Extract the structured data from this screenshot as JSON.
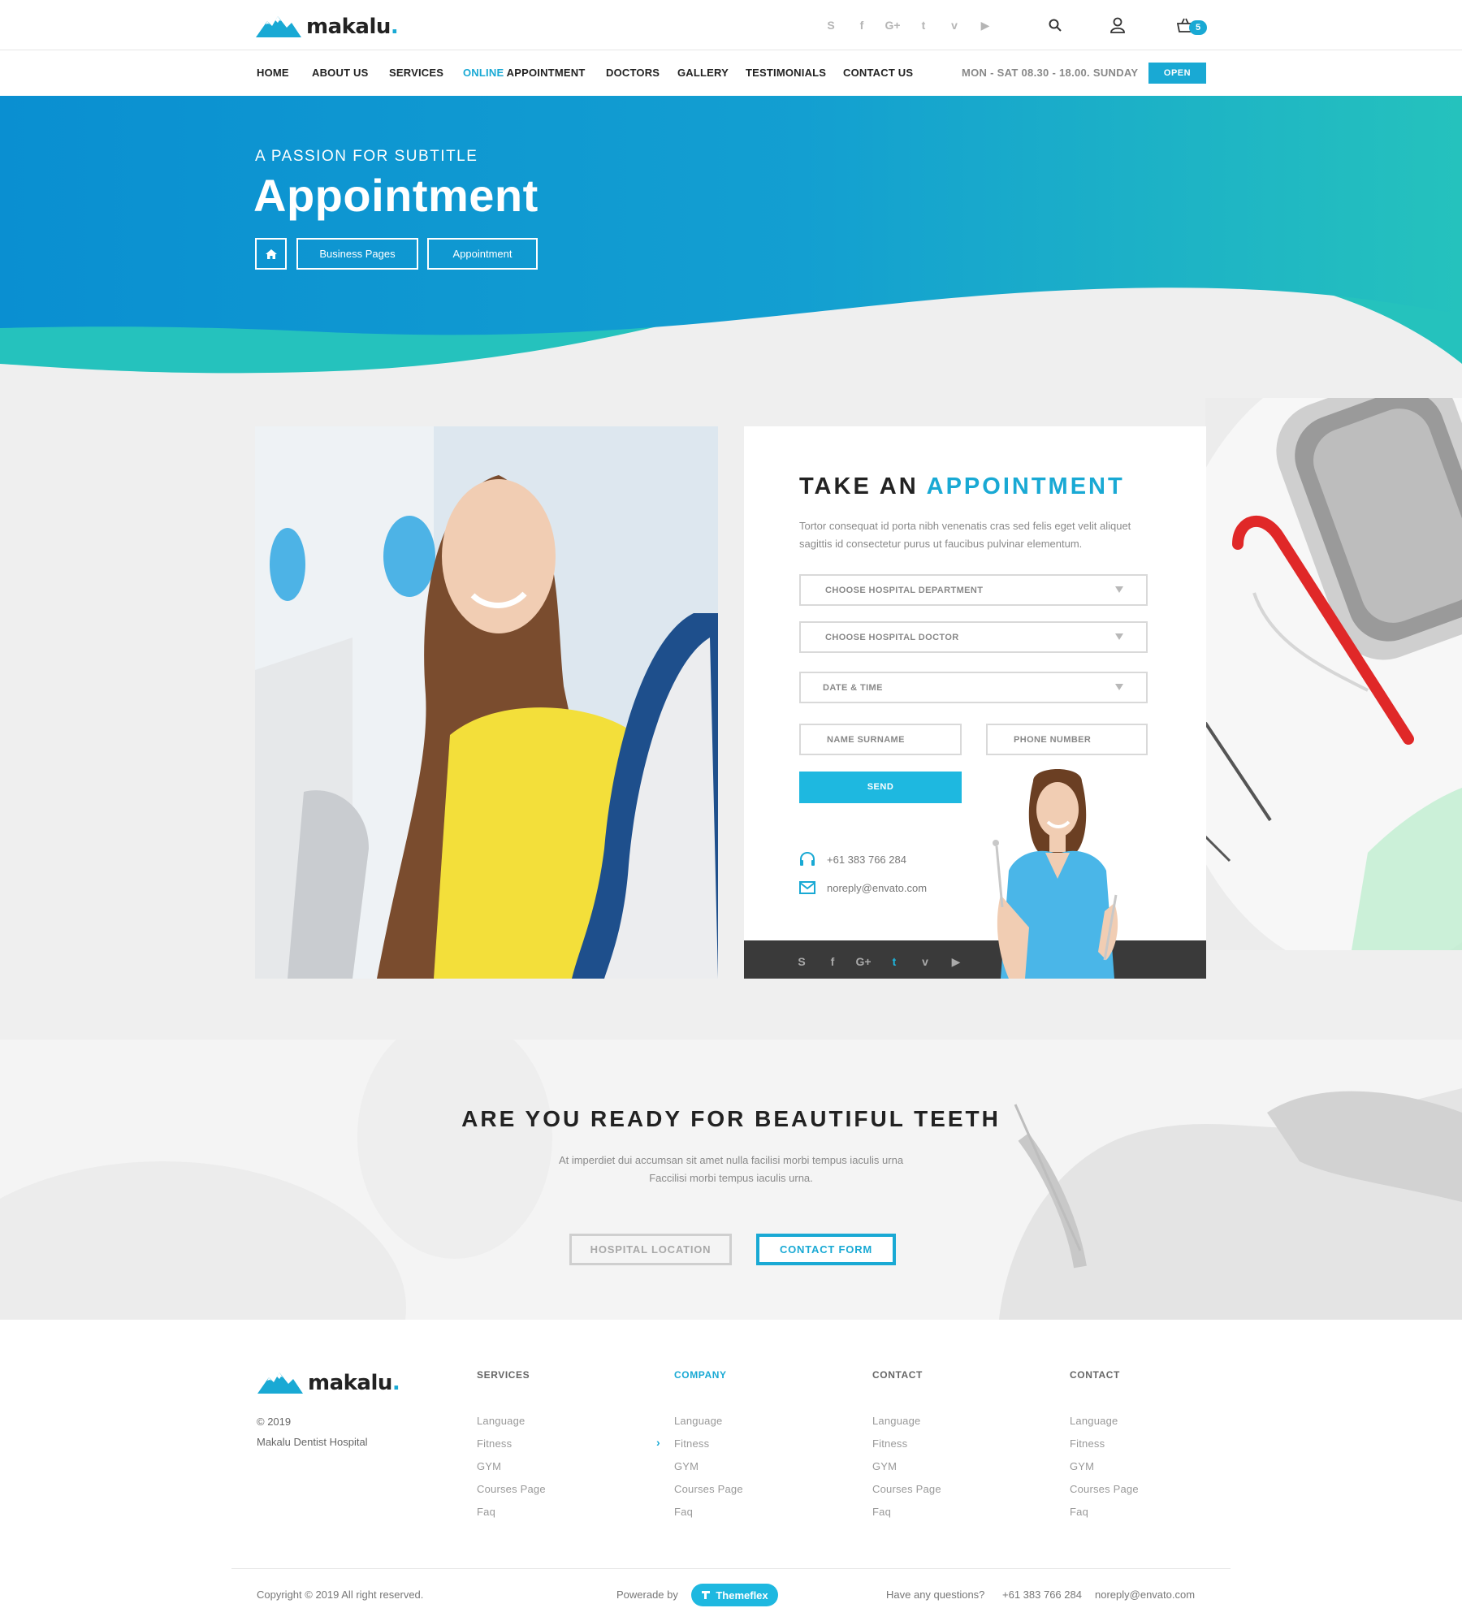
{
  "brand": {
    "name": "makalu",
    "dot": ".",
    "accent": "#19a9d4"
  },
  "topbar": {
    "social_icons": [
      "skype-icon",
      "facebook-icon",
      "google-plus-icon",
      "twitter-icon",
      "vimeo-icon",
      "youtube-icon"
    ],
    "social_glyphs": [
      "S",
      "f",
      "G+",
      "t",
      "v",
      "▶"
    ],
    "cart_count": "5"
  },
  "nav": {
    "items": [
      {
        "label": "HOME"
      },
      {
        "label": "ABOUT US"
      },
      {
        "label": "SERVICES"
      },
      {
        "accent": "ONLINE",
        "label": " APPOINTMENT"
      },
      {
        "label": "DOCTORS"
      },
      {
        "label": "GALLERY"
      },
      {
        "label": "TESTIMONIALS"
      },
      {
        "label": "CONTACT US"
      }
    ],
    "hours": "MON - SAT 08.30 - 18.00. SUNDAY",
    "open_label": "OPEN"
  },
  "hero": {
    "subtitle": "A PASSION FOR SUBTITLE",
    "title": "Appointment",
    "breadcrumbs": [
      "Business Pages",
      "Appointment"
    ]
  },
  "appointment": {
    "title_plain": "TAKE AN ",
    "title_accent": "APPOINTMENT",
    "description": "Tortor consequat id porta nibh venenatis cras sed felis eget velit aliquet sagittis id consectetur purus ut faucibus pulvinar elementum.",
    "department_placeholder": "CHOOSE HOSPITAL DEPARTMENT",
    "doctor_placeholder": "CHOOSE HOSPITAL DOCTOR",
    "datetime_placeholder": "DATE & TIME",
    "name_placeholder": "NAME SURNAME",
    "phone_placeholder": "PHONE NUMBER",
    "send_label": "SEND",
    "phone": "+61 383 766 284",
    "email": "noreply@envato.com",
    "social_glyphs": [
      "S",
      "f",
      "G+",
      "t",
      "v",
      "▶"
    ]
  },
  "cta": {
    "title": "ARE YOU READY FOR BEAUTIFUL TEETH",
    "line1": "At imperdiet dui accumsan sit amet nulla facilisi morbi tempus iaculis urna",
    "line2": "Faccilisi morbi tempus iaculis urna.",
    "location_label": "HOSPITAL LOCATION",
    "contact_label": "CONTACT FORM"
  },
  "footer": {
    "year": "© 2019",
    "org": "Makalu Dentist Hospital",
    "columns": [
      {
        "title": "SERVICES",
        "links": [
          "Language",
          "Fitness",
          "GYM",
          "Courses Page",
          "Faq"
        ]
      },
      {
        "title": "COMPANY",
        "links": [
          "Language",
          "Fitness",
          "GYM",
          "Courses Page",
          "Faq"
        ]
      },
      {
        "title": "CONTACT",
        "links": [
          "Language",
          "Fitness",
          "GYM",
          "Courses Page",
          "Faq"
        ]
      },
      {
        "title": "CONTACT",
        "links": [
          "Language",
          "Fitness",
          "GYM",
          "Courses Page",
          "Faq"
        ]
      }
    ],
    "copyright": "Copyright © 2019 All right reserved.",
    "powered_by": "Powerade by",
    "themeflex": "Themeflex",
    "questions": "Have any questions?",
    "phone": "+61 383 766 284",
    "email": "noreply@envato.com"
  }
}
